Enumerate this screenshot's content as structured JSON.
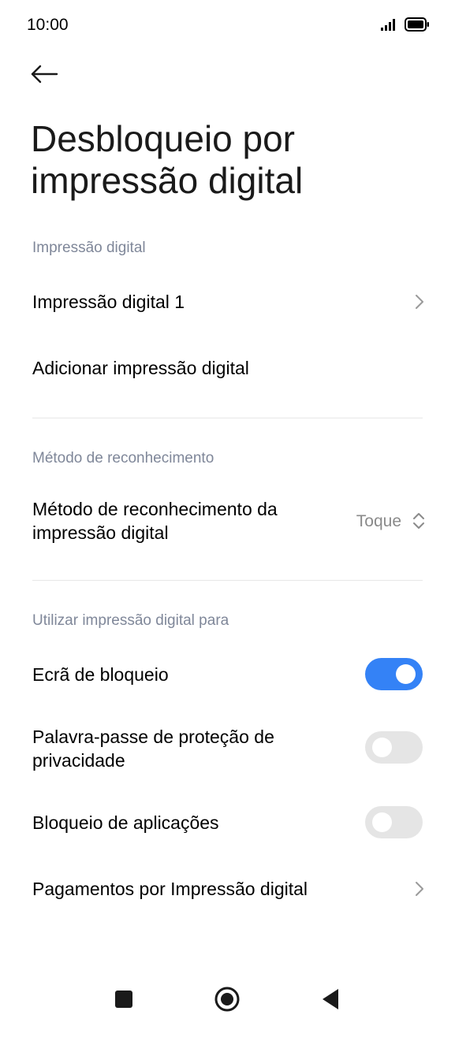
{
  "status_bar": {
    "time": "10:00",
    "icons": [
      "signal-icon",
      "battery-icon"
    ]
  },
  "header": {
    "back_icon": "arrow-left-icon",
    "title": "Desbloqueio por impressão digital"
  },
  "sections": {
    "fingerprints": {
      "header": "Impressão digital",
      "items": [
        {
          "label": "Impressão digital 1",
          "icon": "chevron-right-icon"
        },
        {
          "label": "Adicionar impressão digital"
        }
      ]
    },
    "recognition": {
      "header": "Método de reconhecimento",
      "method_label": "Método de reconhecimento da impressão digital",
      "method_value": "Toque",
      "method_icon": "up-down-chevron-icon"
    },
    "usage": {
      "header": "Utilizar impressão digital para",
      "items": [
        {
          "label": "Ecrã de bloqueio",
          "toggle": true
        },
        {
          "label": "Palavra-passe de proteção de privacidade",
          "toggle": false
        },
        {
          "label": "Bloqueio de aplicações",
          "toggle": false
        },
        {
          "label": "Pagamentos por Impressão digital",
          "icon": "chevron-right-icon"
        }
      ]
    }
  },
  "nav_bar": {
    "buttons": [
      "recents-square-icon",
      "home-circle-icon",
      "back-triangle-icon"
    ]
  },
  "colors": {
    "accent": "#3482f6",
    "section_header": "#7f8799",
    "toggle_off": "#e5e5e5"
  }
}
